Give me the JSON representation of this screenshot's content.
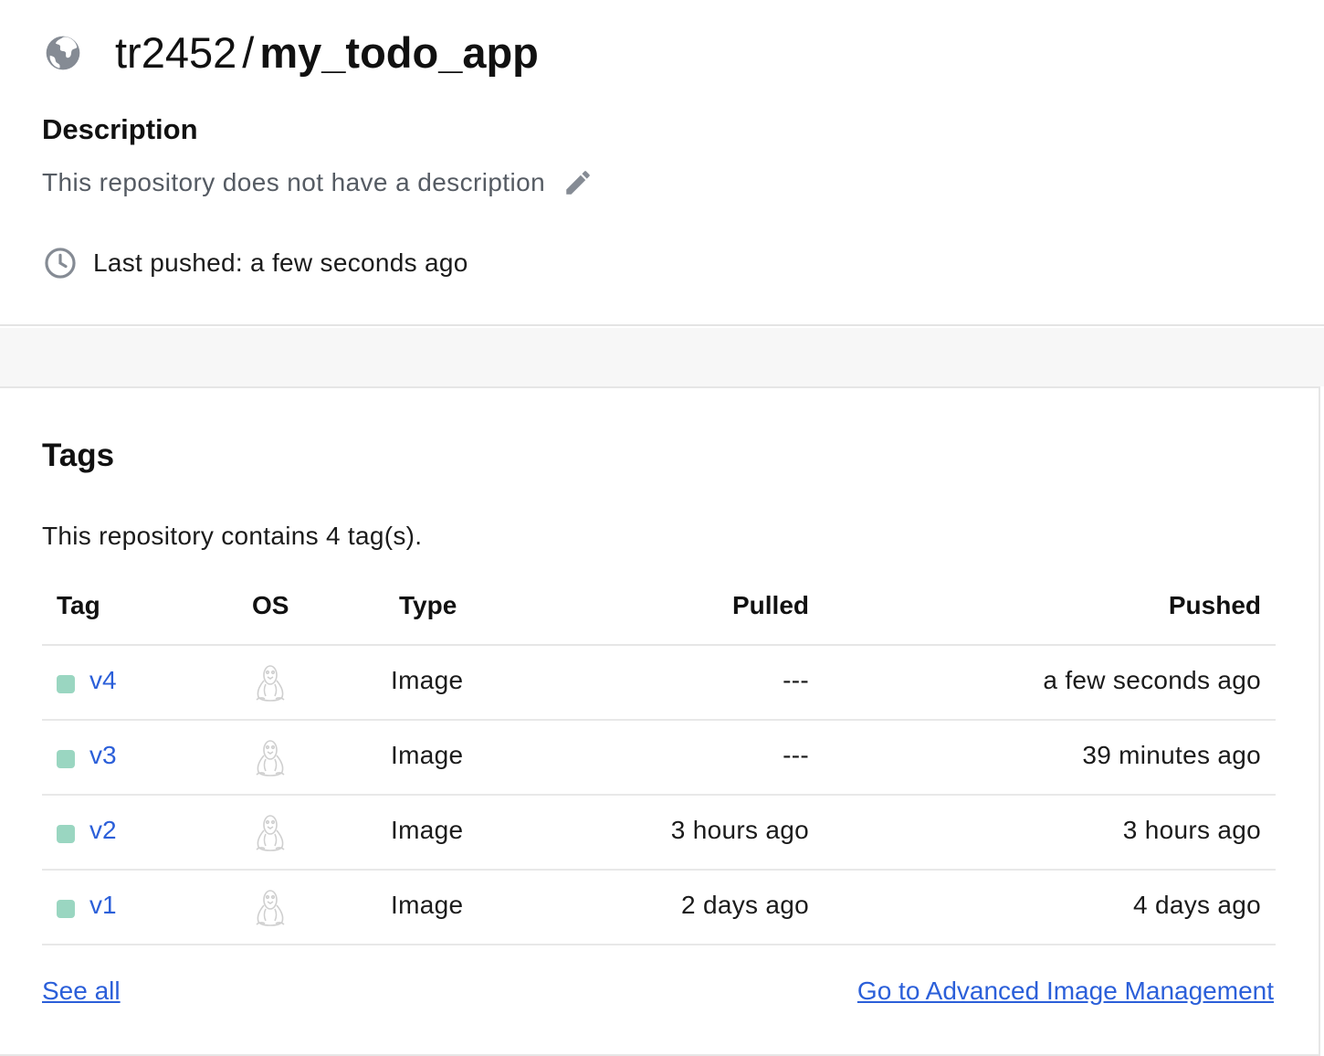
{
  "header": {
    "owner": "tr2452",
    "separator": "/",
    "repo": "my_todo_app",
    "icon": "globe-icon"
  },
  "description": {
    "heading": "Description",
    "text": "This repository does not have a description",
    "edit_icon": "pencil-icon"
  },
  "last_pushed": {
    "icon": "clock-icon",
    "text": "Last pushed: a few seconds ago"
  },
  "tags": {
    "heading": "Tags",
    "summary": "This repository contains 4 tag(s).",
    "columns": {
      "tag": "Tag",
      "os": "OS",
      "type": "Type",
      "pulled": "Pulled",
      "pushed": "Pushed"
    },
    "rows": [
      {
        "tag": "v4",
        "os_icon": "linux-icon",
        "type": "Image",
        "pulled": "---",
        "pushed": "a few seconds ago"
      },
      {
        "tag": "v3",
        "os_icon": "linux-icon",
        "type": "Image",
        "pulled": "---",
        "pushed": "39 minutes ago"
      },
      {
        "tag": "v2",
        "os_icon": "linux-icon",
        "type": "Image",
        "pulled": "3 hours ago",
        "pushed": "3 hours ago"
      },
      {
        "tag": "v1",
        "os_icon": "linux-icon",
        "type": "Image",
        "pulled": "2 days ago",
        "pushed": "4 days ago"
      }
    ],
    "see_all": "See all",
    "advanced_link": "Go to Advanced Image Management"
  },
  "colors": {
    "link": "#2b5fd9",
    "status_dot": "#9ad6c1",
    "muted_icon": "#858b94"
  }
}
